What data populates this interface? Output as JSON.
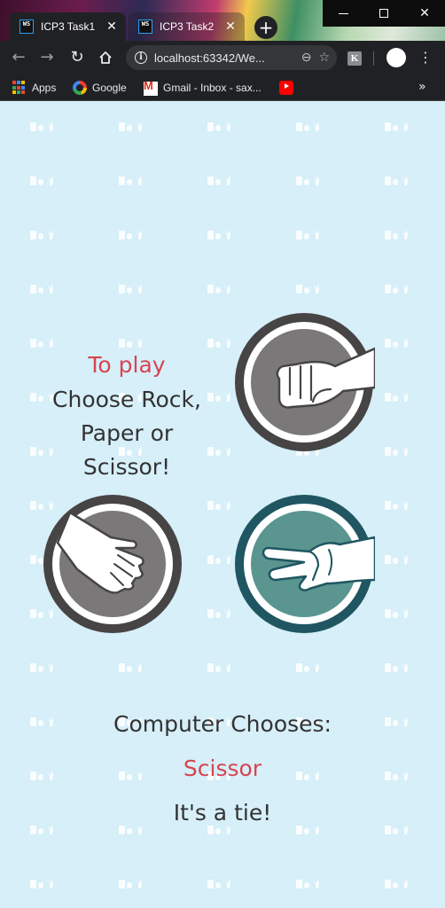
{
  "browser": {
    "tabs": [
      {
        "title": "ICP3 Task1",
        "favicon": "WS",
        "active": true
      },
      {
        "title": "ICP3 Task2",
        "favicon": "WS",
        "active": false
      }
    ],
    "url": "localhost:63342/We...",
    "extension_letter": "K",
    "bookmarks": [
      {
        "label": "Apps",
        "icon": "apps-grid-icon"
      },
      {
        "label": "Google",
        "icon": "google-icon"
      },
      {
        "label": "Gmail - Inbox - sax...",
        "icon": "gmail-icon"
      },
      {
        "label": "",
        "icon": "youtube-icon"
      }
    ]
  },
  "game": {
    "instructions": {
      "title": "To play",
      "line1": "Choose Rock,",
      "line2": "Paper or",
      "line3": "Scissor!"
    },
    "choices": [
      {
        "name": "rock",
        "selected": false
      },
      {
        "name": "paper",
        "selected": false
      },
      {
        "name": "scissor",
        "selected": true
      }
    ],
    "result": {
      "computer_label": "Computer Chooses:",
      "computer_choice": "Scissor",
      "outcome": "It's a tie!"
    },
    "colors": {
      "background": "#d6eff9",
      "accent_text": "#d64550",
      "body_text": "#333333",
      "choice_ring": "#474445",
      "choice_fill": "#7a7879",
      "selected_ring": "#1f5661",
      "selected_fill": "#5a958f"
    }
  }
}
